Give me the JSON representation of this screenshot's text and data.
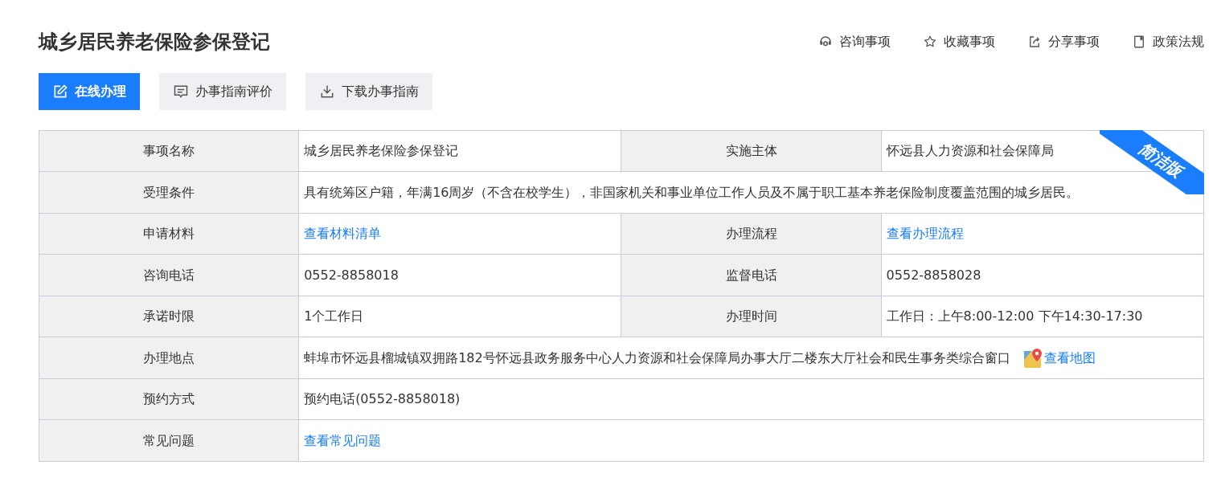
{
  "title": "城乡居民养老保险参保登记",
  "header_actions": [
    {
      "kind": "headset",
      "label": "咨询事项"
    },
    {
      "kind": "star",
      "label": "收藏事项"
    },
    {
      "kind": "share",
      "label": "分享事项"
    },
    {
      "kind": "book",
      "label": "政策法规"
    }
  ],
  "buttons": [
    {
      "kind": "edit",
      "label": "在线办理",
      "primary": true
    },
    {
      "kind": "comment",
      "label": "办事指南评价",
      "primary": false
    },
    {
      "kind": "download",
      "label": "下载办事指南",
      "primary": false
    }
  ],
  "ribbon": "简洁版",
  "table": {
    "rows": [
      [
        {
          "kind": "label",
          "text": "事项名称"
        },
        {
          "kind": "value",
          "text": "城乡居民养老保险参保登记"
        },
        {
          "kind": "label",
          "text": "实施主体"
        },
        {
          "kind": "value",
          "text": "怀远县人力资源和社会保障局"
        }
      ],
      [
        {
          "kind": "label",
          "text": "受理条件"
        },
        {
          "kind": "value",
          "colspan": 3,
          "text": "具有统筹区户籍，年满16周岁（不含在校学生），非国家机关和事业单位工作人员及不属于职工基本养老保险制度覆盖范围的城乡居民。"
        }
      ],
      [
        {
          "kind": "label",
          "text": "申请材料"
        },
        {
          "kind": "link",
          "text": "查看材料清单"
        },
        {
          "kind": "label",
          "text": "办理流程"
        },
        {
          "kind": "link",
          "text": "查看办理流程"
        }
      ],
      [
        {
          "kind": "label",
          "text": "咨询电话"
        },
        {
          "kind": "value",
          "text": "0552-8858018"
        },
        {
          "kind": "label",
          "text": "监督电话"
        },
        {
          "kind": "value",
          "text": "0552-8858028"
        }
      ],
      [
        {
          "kind": "label",
          "text": "承诺时限"
        },
        {
          "kind": "value",
          "text": "1个工作日"
        },
        {
          "kind": "label",
          "text": "办理时间"
        },
        {
          "kind": "value",
          "text": "工作日：上午8:00-12:00 下午14:30-17:30"
        }
      ],
      [
        {
          "kind": "label",
          "text": "办理地点"
        },
        {
          "kind": "value",
          "colspan": 3,
          "text": "蚌埠市怀远县榴城镇双拥路182号怀远县政务服务中心人力资源和社会保障局办事大厅二楼东大厅社会和民生事务类综合窗口",
          "map_link": "查看地图"
        }
      ],
      [
        {
          "kind": "label",
          "text": "预约方式"
        },
        {
          "kind": "value",
          "colspan": 3,
          "text": "预约电话(0552-8858018)"
        }
      ],
      [
        {
          "kind": "label",
          "text": "常见问题"
        },
        {
          "kind": "link",
          "colspan": 3,
          "text": "查看常见问题"
        }
      ]
    ]
  }
}
